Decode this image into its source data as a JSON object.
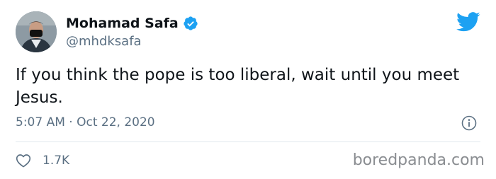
{
  "author": {
    "name": "Mohamad Safa",
    "handle": "@mhdksafa",
    "verified": true
  },
  "tweet": {
    "text": "If you think the pope is too liberal, wait until you meet Jesus.",
    "timestamp": "5:07 AM · Oct 22, 2020"
  },
  "engagement": {
    "likes": "1.7K"
  },
  "watermark": "boredpanda.com",
  "colors": {
    "twitter_blue": "#1da1f2",
    "secondary_text": "#5b7083",
    "primary_text": "#0f1419"
  },
  "icons": {
    "logo": "twitter-bird-icon",
    "verified": "verified-badge-icon",
    "info": "info-icon",
    "like": "heart-icon"
  }
}
